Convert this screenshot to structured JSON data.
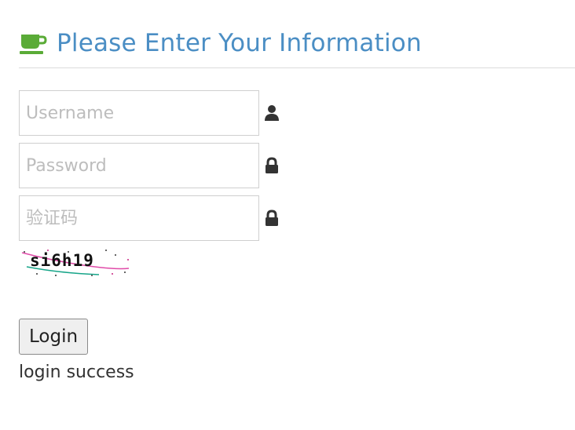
{
  "header": {
    "title": "Please Enter Your Information",
    "icon": "coffee-cup-icon",
    "icon_color": "#5aab37",
    "title_color": "#4b8ec4"
  },
  "form": {
    "username": {
      "value": "",
      "placeholder": "Username",
      "icon": "user-icon"
    },
    "password": {
      "value": "",
      "placeholder": "Password",
      "icon": "lock-icon"
    },
    "captcha_input": {
      "value": "",
      "placeholder": "验证码",
      "icon": "lock-icon"
    },
    "captcha_text": "si6h19",
    "login_label": "Login"
  },
  "status": {
    "message": "login success"
  }
}
